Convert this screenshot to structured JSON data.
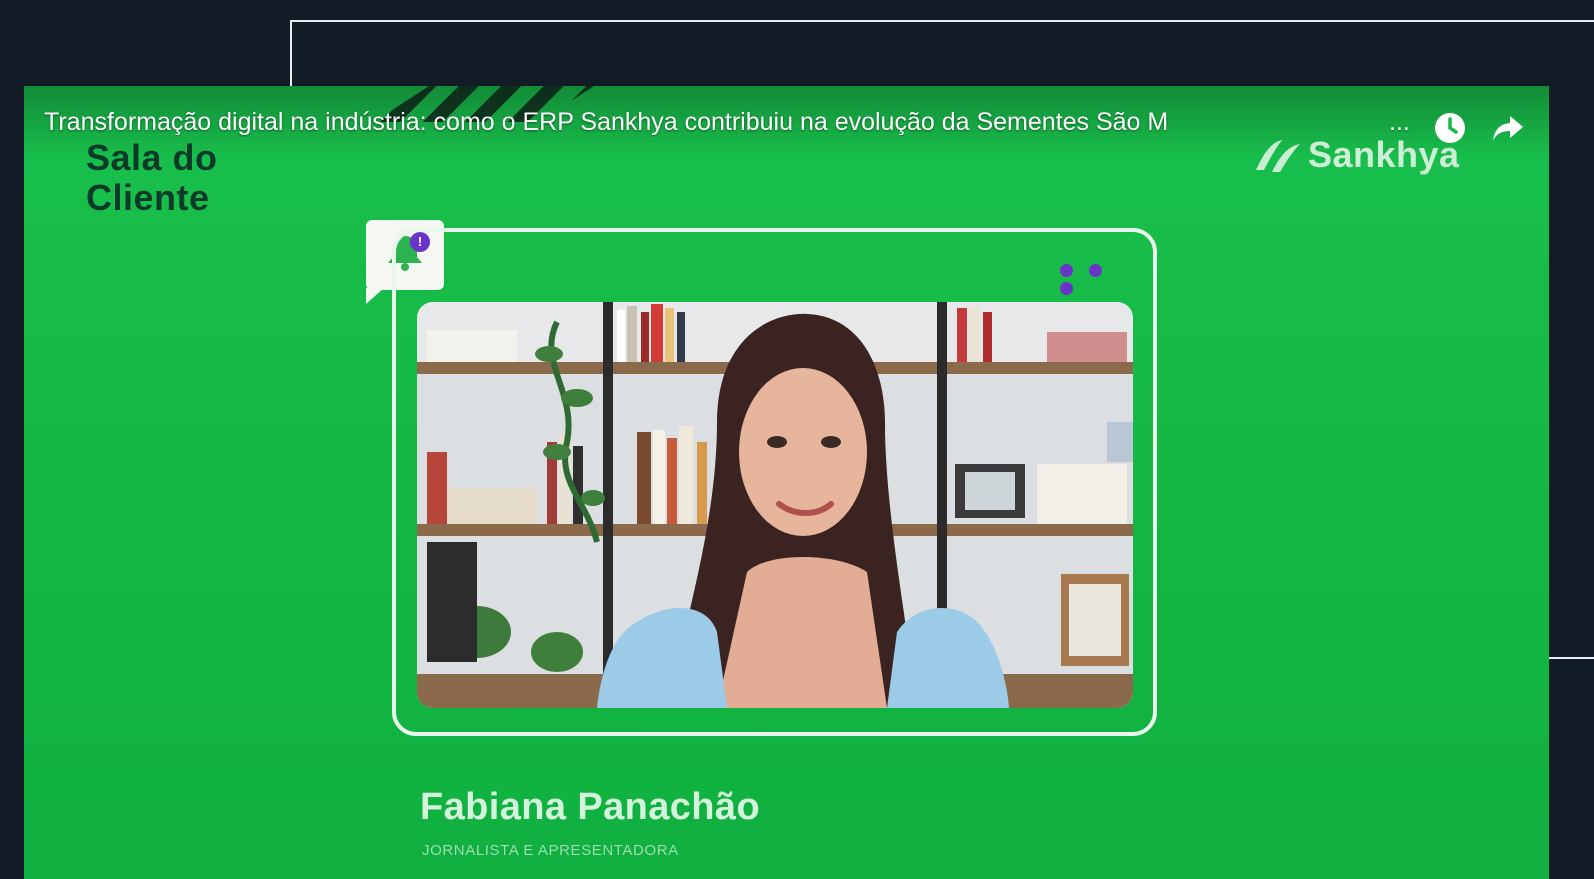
{
  "video": {
    "title": "Transformação digital na indústria: como o ERP Sankhya contribuiu na evolução da Sementes São M",
    "title_truncation": "..."
  },
  "controls": {
    "watch_later_icon": "clock-icon",
    "share_icon": "share-arrow-icon"
  },
  "overlay": {
    "show_title_line1": "Sala do",
    "show_title_line2": "Cliente",
    "brand_name": "Sankhya",
    "notification_count": "!",
    "speaker_name": "Fabiana Panachão",
    "speaker_role": "JORNALISTA E APRESENTADORA"
  },
  "colors": {
    "background": "#121c27",
    "green": "#16b945",
    "dark_green_text": "#0c3a2a",
    "accent_purple": "#6a33c9",
    "frame_white": "#e8f6ec"
  }
}
